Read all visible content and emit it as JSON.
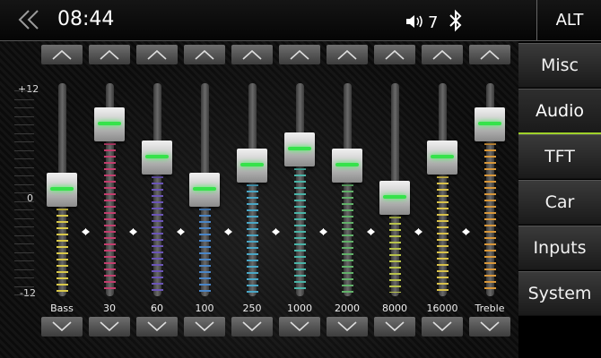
{
  "status_bar": {
    "time": "08:44",
    "volume": "7",
    "alt_label": "ALT"
  },
  "axis": {
    "max_label": "+12",
    "zero_label": "0",
    "min_label": "-12"
  },
  "bands": [
    {
      "label": "Bass",
      "level": 0,
      "color": "#d9c94a"
    },
    {
      "label": "30",
      "level": 8,
      "color": "#c43e6e"
    },
    {
      "label": "60",
      "level": 4,
      "color": "#6b55b8"
    },
    {
      "label": "100",
      "level": 0,
      "color": "#4a86c8"
    },
    {
      "label": "250",
      "level": 3,
      "color": "#4aa7c6"
    },
    {
      "label": "1000",
      "level": 5,
      "color": "#4ab5a8"
    },
    {
      "label": "2000",
      "level": 3,
      "color": "#62b26a"
    },
    {
      "label": "8000",
      "level": -1,
      "color": "#b8c24a"
    },
    {
      "label": "16000",
      "level": 4,
      "color": "#d9c24a"
    },
    {
      "label": "Treble",
      "level": 8,
      "color": "#d9983a"
    }
  ],
  "menu": [
    {
      "label": "Misc",
      "active": false
    },
    {
      "label": "Audio",
      "active": true
    },
    {
      "label": "TFT",
      "active": false
    },
    {
      "label": "Car",
      "active": false
    },
    {
      "label": "Inputs",
      "active": false
    },
    {
      "label": "System",
      "active": false
    }
  ],
  "icons": {
    "back": "double-chevron-left-icon",
    "volume": "speaker-icon",
    "bluetooth": "bluetooth-icon",
    "up": "triangle-up-icon",
    "down": "triangle-down-icon"
  }
}
